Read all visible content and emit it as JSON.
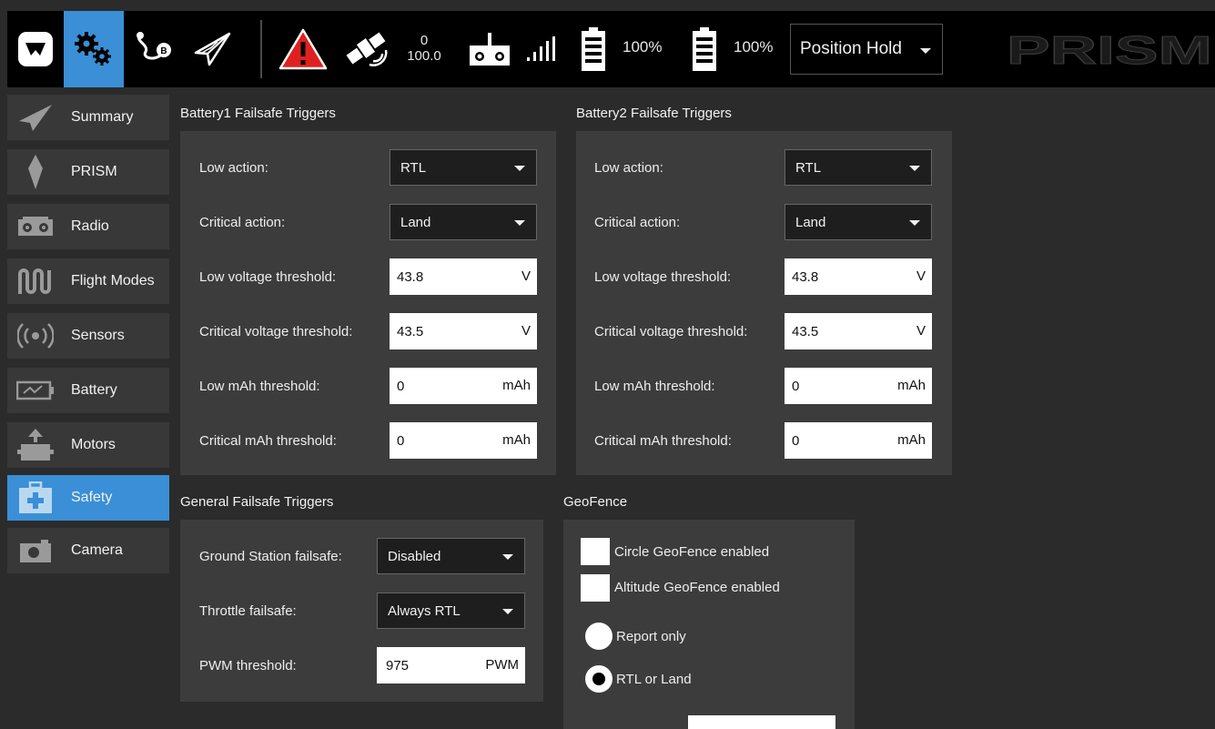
{
  "toolbar": {
    "gps_count": "0",
    "gps_hdop": "100.0",
    "battery1": "100%",
    "battery2": "100%",
    "flight_mode": "Position Hold",
    "brand": "PRISM",
    "accent_color": "#3a8fd6",
    "warning_color": "#e02020"
  },
  "sidebar": {
    "items": [
      {
        "label": "Summary",
        "icon": "paper-plane-icon"
      },
      {
        "label": "PRISM",
        "icon": "prism-icon"
      },
      {
        "label": "Radio",
        "icon": "radio-icon"
      },
      {
        "label": "Flight Modes",
        "icon": "flight-modes-icon"
      },
      {
        "label": "Sensors",
        "icon": "sensors-icon"
      },
      {
        "label": "Battery",
        "icon": "battery-icon"
      },
      {
        "label": "Motors",
        "icon": "motors-icon"
      },
      {
        "label": "Safety",
        "icon": "first-aid-icon"
      },
      {
        "label": "Camera",
        "icon": "camera-icon"
      }
    ],
    "active": "Safety"
  },
  "battery1": {
    "title": "Battery1 Failsafe Triggers",
    "low_action_label": "Low action:",
    "low_action_value": "RTL",
    "critical_action_label": "Critical action:",
    "critical_action_value": "Land",
    "low_voltage_label": "Low voltage threshold:",
    "low_voltage_value": "43.8",
    "critical_voltage_label": "Critical voltage threshold:",
    "critical_voltage_value": "43.5",
    "voltage_unit": "V",
    "low_mah_label": "Low mAh threshold:",
    "low_mah_value": "0",
    "critical_mah_label": "Critical mAh threshold:",
    "critical_mah_value": "0",
    "mah_unit": "mAh"
  },
  "battery2": {
    "title": "Battery2 Failsafe Triggers",
    "low_action_label": "Low action:",
    "low_action_value": "RTL",
    "critical_action_label": "Critical action:",
    "critical_action_value": "Land",
    "low_voltage_label": "Low voltage threshold:",
    "low_voltage_value": "43.8",
    "critical_voltage_label": "Critical voltage threshold:",
    "critical_voltage_value": "43.5",
    "voltage_unit": "V",
    "low_mah_label": "Low mAh threshold:",
    "low_mah_value": "0",
    "critical_mah_label": "Critical mAh threshold:",
    "critical_mah_value": "0",
    "mah_unit": "mAh"
  },
  "general": {
    "title": "General Failsafe Triggers",
    "gcs_label": "Ground Station failsafe:",
    "gcs_value": "Disabled",
    "throttle_label": "Throttle failsafe:",
    "throttle_value": "Always RTL",
    "pwm_label": "PWM threshold:",
    "pwm_value": "975",
    "pwm_unit": "PWM"
  },
  "geofence": {
    "title": "GeoFence",
    "circle_label": "Circle GeoFence enabled",
    "circle_checked": false,
    "altitude_label": "Altitude GeoFence enabled",
    "altitude_checked": false,
    "report_label": "Report only",
    "rtl_label": "RTL or Land",
    "selected_action": "RTL or Land"
  }
}
